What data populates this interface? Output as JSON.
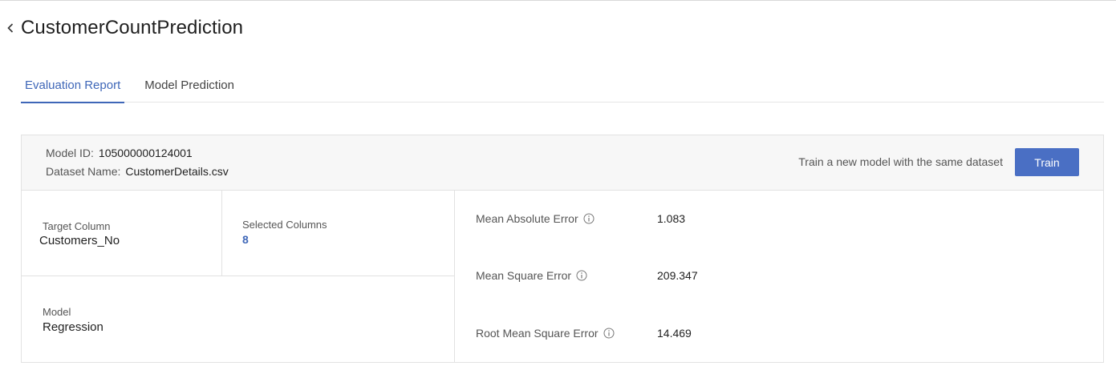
{
  "header": {
    "title": "CustomerCountPrediction"
  },
  "tabs": [
    {
      "label": "Evaluation Report",
      "active": true
    },
    {
      "label": "Model Prediction",
      "active": false
    }
  ],
  "model_info": {
    "model_id_label": "Model ID:",
    "model_id_value": "105000000124001",
    "dataset_label": "Dataset Name:",
    "dataset_value": "CustomerDetails.csv",
    "train_hint": "Train a new model with the same dataset",
    "train_button": "Train"
  },
  "details": {
    "target_column_label": "Target Column",
    "target_column_value": "Customers_No",
    "selected_columns_label": "Selected Columns",
    "selected_columns_value": "8",
    "model_label": "Model",
    "model_value": "Regression"
  },
  "metrics": [
    {
      "label": "Mean Absolute Error",
      "value": "1.083"
    },
    {
      "label": "Mean Square Error",
      "value": "209.347"
    },
    {
      "label": "Root Mean Square Error",
      "value": "14.469"
    }
  ],
  "colors": {
    "accent": "#3f67b8",
    "button": "#4a6fc4"
  },
  "icons": [
    "chevron-left-icon",
    "info-icon"
  ]
}
